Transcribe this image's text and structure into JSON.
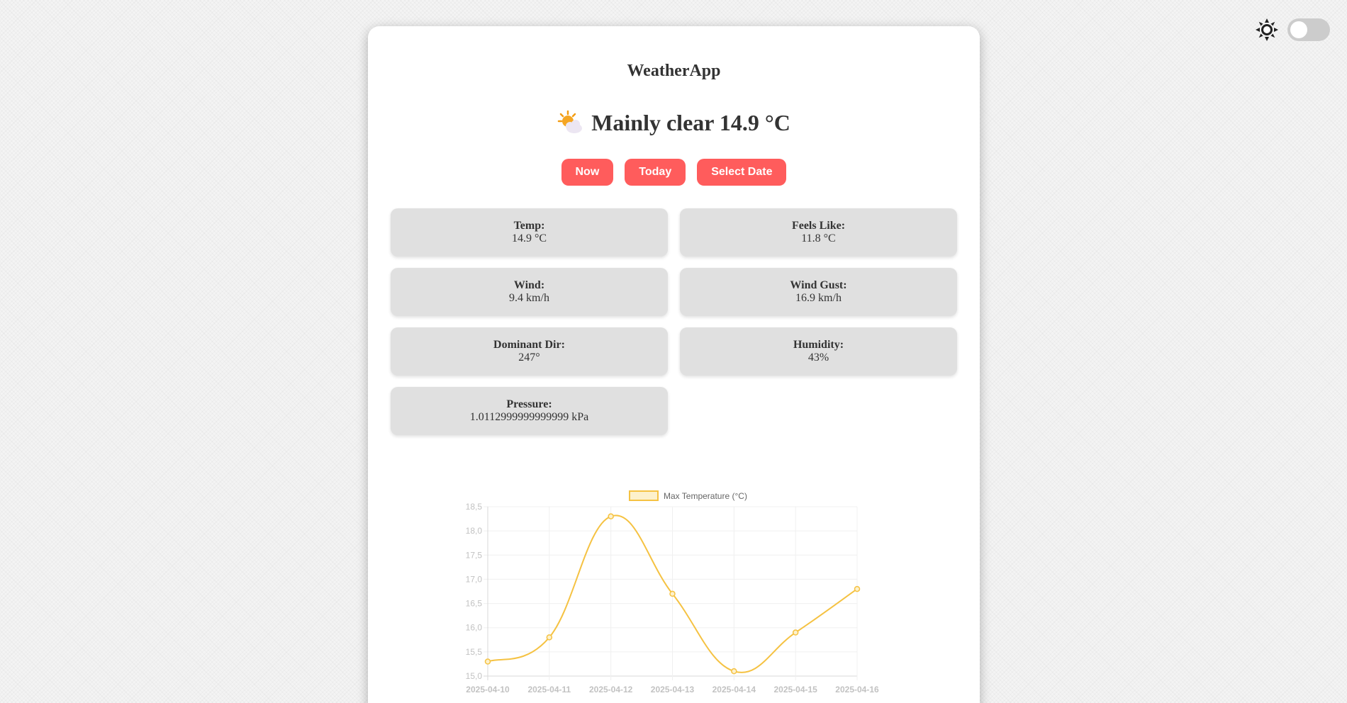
{
  "app": {
    "title": "WeatherApp"
  },
  "current": {
    "icon": "sun-behind-cloud-icon",
    "summary": "Mainly clear 14.9 °C"
  },
  "buttons": [
    {
      "label": "Now"
    },
    {
      "label": "Today"
    },
    {
      "label": "Select Date"
    }
  ],
  "metrics": [
    {
      "label": "Temp:",
      "value": "14.9 °C"
    },
    {
      "label": "Feels Like:",
      "value": "11.8 °C"
    },
    {
      "label": "Wind:",
      "value": "9.4 km/h"
    },
    {
      "label": "Wind Gust:",
      "value": "16.9 km/h"
    },
    {
      "label": "Dominant Dir:",
      "value": "247°"
    },
    {
      "label": "Humidity:",
      "value": "43%"
    },
    {
      "label": "Pressure:",
      "value": "1.0112999999999999 kPa"
    }
  ],
  "theme": {
    "icon": "sun-icon",
    "dark_mode": false
  },
  "colors": {
    "accent": "#ff5c5c",
    "tile_bg": "#e0e0e0",
    "line": "#f5c242",
    "line_fill": "#fdf1cc"
  },
  "chart_data": {
    "type": "line",
    "x": [
      "2025-04-10",
      "2025-04-11",
      "2025-04-12",
      "2025-04-13",
      "2025-04-14",
      "2025-04-15",
      "2025-04-16"
    ],
    "series": [
      {
        "name": "Max Temperature (°C)",
        "values": [
          15.3,
          15.8,
          18.3,
          16.7,
          15.1,
          15.9,
          16.8
        ]
      }
    ],
    "yticks": [
      "15,0",
      "15,5",
      "16,0",
      "16,5",
      "17,0",
      "17,5",
      "18,0",
      "18,5"
    ],
    "ylim": [
      15.0,
      18.5
    ],
    "grid": true,
    "legend": "top"
  }
}
